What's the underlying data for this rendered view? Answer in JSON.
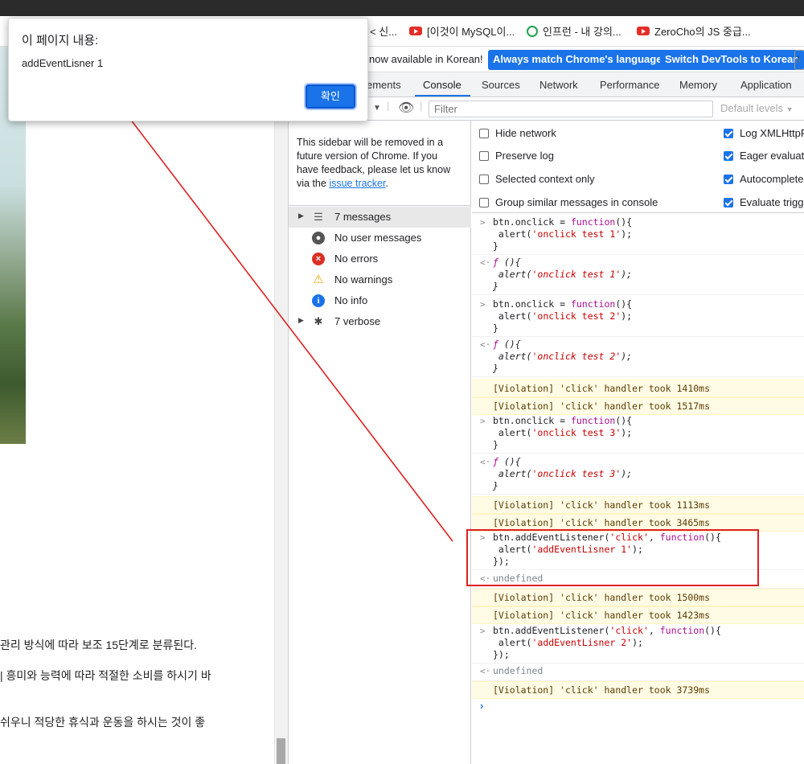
{
  "bookmarks": [
    {
      "label": "< 신...",
      "icon": "none"
    },
    {
      "label": "[이것이 MySQL이...",
      "icon": "youtube-icon"
    },
    {
      "label": "인프런 - 내 강의...",
      "icon": "inflearn-icon"
    },
    {
      "label": "ZeroCho의 JS 중급...",
      "icon": "youtube-icon"
    }
  ],
  "webpage": {
    "lines": [
      "관리 방식에 따라 보조 15단계로 분류된다.",
      "| 흥미와 능력에 따라 적절한 소비를 하시기 바",
      "쉬우니 적당한 휴식과 운동을 하시는 것이 좋"
    ]
  },
  "devtools": {
    "infobar": {
      "text": "now available in Korean!",
      "btn_match": "Always match Chrome's language",
      "btn_switch": "Switch DevTools to Korean",
      "btn_stub": "I"
    },
    "tabs": [
      "ements",
      "Console",
      "Sources",
      "Network",
      "Performance",
      "Memory",
      "Application"
    ],
    "toolbar": {
      "filter_placeholder": "Filter",
      "levels": "Default levels"
    },
    "sidebar": {
      "notice_text": "This sidebar will be removed in a future version of Chrome. If you have feedback, please let us know via the ",
      "notice_link": "issue tracker",
      "notice_end": ".",
      "items": [
        {
          "label": "7 messages"
        },
        {
          "label": "No user messages"
        },
        {
          "label": "No errors"
        },
        {
          "label": "No warnings"
        },
        {
          "label": "No info"
        },
        {
          "label": "7 verbose"
        }
      ]
    },
    "settings": {
      "left": [
        {
          "label": "Hide network",
          "checked": false
        },
        {
          "label": "Preserve log",
          "checked": false
        },
        {
          "label": "Selected context only",
          "checked": false
        },
        {
          "label": "Group similar messages in console",
          "checked": false
        }
      ],
      "right": [
        {
          "label": "Log XMLHttpR",
          "checked": true
        },
        {
          "label": "Eager evaluati",
          "checked": true
        },
        {
          "label": "Autocomplete",
          "checked": true
        },
        {
          "label": "Evaluate trigg",
          "checked": true
        }
      ]
    },
    "console": {
      "violations": [
        "[Violation] 'click' handler took 1410ms",
        "[Violation] 'click' handler took 1517ms",
        "[Violation] 'click' handler took 1113ms",
        "[Violation] 'click' handler took 3465ms",
        "[Violation] 'click' handler took 1500ms",
        "[Violation] 'click' handler took 1423ms",
        "[Violation] 'click' handler took 3739ms"
      ],
      "undefined_label": "undefined"
    }
  },
  "dialog": {
    "title": "이 페이지 내용:",
    "message": "addEventLisner 1",
    "ok_label": "확인"
  }
}
